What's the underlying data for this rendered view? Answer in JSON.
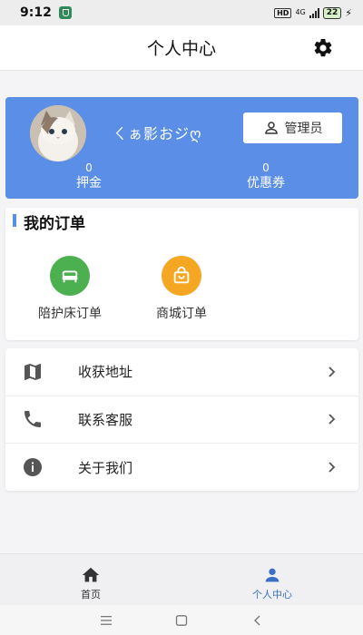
{
  "status_bar": {
    "time": "9:12",
    "hd": "HD",
    "network": "4G",
    "battery": "22"
  },
  "header": {
    "title": "个人中心",
    "settings_icon": "gear-icon"
  },
  "profile": {
    "username": "ㄑぁ影おジღ",
    "admin_label": "管理员",
    "admin_icon": "person-outline-icon",
    "accent_color": "#5b8ee6",
    "stats": [
      {
        "value": "0",
        "label": "押金"
      },
      {
        "value": "0",
        "label": "优惠券"
      }
    ]
  },
  "orders": {
    "title": "我的订单",
    "items": [
      {
        "label": "陪护床订单",
        "icon": "bed-icon",
        "color": "#4caf50"
      },
      {
        "label": "商城订单",
        "icon": "shopping-bag-icon",
        "color": "#f5a623"
      }
    ]
  },
  "menu": {
    "items": [
      {
        "label": "收获地址",
        "icon": "map-icon"
      },
      {
        "label": "联系客服",
        "icon": "phone-icon"
      },
      {
        "label": "关于我们",
        "icon": "info-icon"
      }
    ]
  },
  "bottom_nav": {
    "items": [
      {
        "label": "首页",
        "icon": "home-icon"
      },
      {
        "label": "个人中心",
        "icon": "person-icon",
        "active": true
      }
    ],
    "active_color": "#3a6fc4"
  }
}
